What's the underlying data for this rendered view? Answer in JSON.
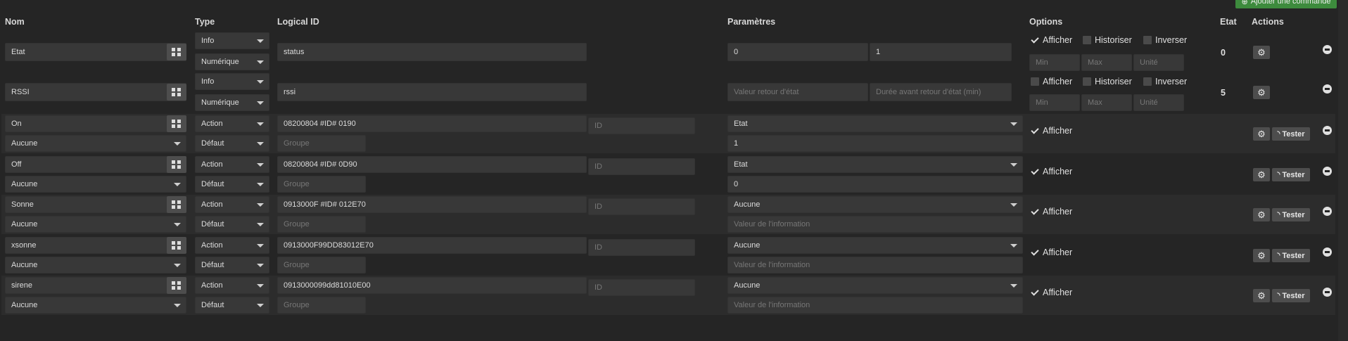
{
  "headers": {
    "nom": "Nom",
    "type": "Type",
    "logical_id": "Logical ID",
    "parametres": "Paramètres",
    "options": "Options",
    "etat": "Etat",
    "actions": "Actions"
  },
  "add_button_label": "Ajouter une commande",
  "info_rows": [
    {
      "name": "Etat",
      "type": "Info",
      "subtype": "Numérique",
      "logical_id": "status",
      "param1": "0",
      "param1_placeholder": "Valeur retour d'état",
      "param2": "1",
      "param2_placeholder": "Durée avant retour d'état (min)",
      "opt_afficher": "Afficher",
      "opt_historiser": "Historiser",
      "opt_inverser": "Inverser",
      "min_placeholder": "Min",
      "max_placeholder": "Max",
      "unit_placeholder": "Unité",
      "etat": "0"
    },
    {
      "name": "RSSI",
      "type": "Info",
      "subtype": "Numérique",
      "logical_id": "rssi",
      "param1": "",
      "param1_placeholder": "Valeur retour d'état",
      "param2": "",
      "param2_placeholder": "Durée avant retour d'état (min)",
      "opt_afficher": "Afficher",
      "opt_historiser": "Historiser",
      "opt_inverser": "Inverser",
      "min_placeholder": "Min",
      "max_placeholder": "Max",
      "unit_placeholder": "Unité",
      "etat": "5"
    }
  ],
  "action_rows": [
    {
      "name": "On",
      "link": "Aucune",
      "type": "Action",
      "subtype": "Défaut",
      "logical_id": "08200804 #ID# 0190",
      "id_placeholder": "ID",
      "group_placeholder": "Groupe",
      "param_select": "Etat",
      "param_value": "1",
      "param_placeholder": "Valeur de l'information",
      "opt_afficher": "Afficher",
      "test_label": "Tester"
    },
    {
      "name": "Off",
      "link": "Aucune",
      "type": "Action",
      "subtype": "Défaut",
      "logical_id": "08200804 #ID# 0D90",
      "id_placeholder": "ID",
      "group_placeholder": "Groupe",
      "param_select": "Etat",
      "param_value": "0",
      "param_placeholder": "Valeur de l'information",
      "opt_afficher": "Afficher",
      "test_label": "Tester"
    },
    {
      "name": "Sonne",
      "link": "Aucune",
      "type": "Action",
      "subtype": "Défaut",
      "logical_id": "0913000F #ID# 012E70",
      "id_placeholder": "ID",
      "group_placeholder": "Groupe",
      "param_select": "Aucune",
      "param_value": "",
      "param_placeholder": "Valeur de l'information",
      "opt_afficher": "Afficher",
      "test_label": "Tester"
    },
    {
      "name": "xsonne",
      "link": "Aucune",
      "type": "Action",
      "subtype": "Défaut",
      "logical_id": "0913000F99DD83012E70",
      "id_placeholder": "ID",
      "group_placeholder": "Groupe",
      "param_select": "Aucune",
      "param_value": "",
      "param_placeholder": "Valeur de l'information",
      "opt_afficher": "Afficher",
      "test_label": "Tester"
    },
    {
      "name": "sirene",
      "link": "Aucune",
      "type": "Action",
      "subtype": "Défaut",
      "logical_id": "0913000099dd81010E00",
      "id_placeholder": "ID",
      "group_placeholder": "Groupe",
      "param_select": "Aucune",
      "param_value": "",
      "param_placeholder": "Valeur de l'information",
      "opt_afficher": "Afficher",
      "test_label": "Tester"
    }
  ],
  "colors": {
    "background": "#252525",
    "row_alt": "#2c2c2c",
    "input": "#383838",
    "add_button": "#3d8b3d"
  }
}
